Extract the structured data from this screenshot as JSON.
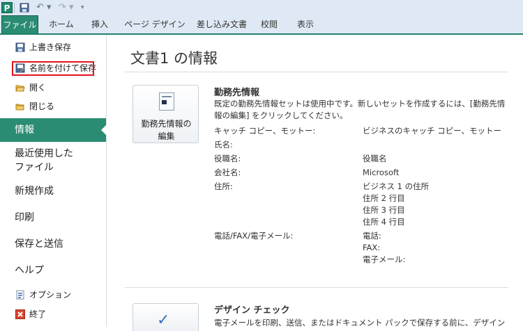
{
  "quick_access": {
    "app_icon": "P",
    "save_icon": "save-icon",
    "undo_icon": "undo-icon",
    "redo_icon": "redo-icon"
  },
  "tabs": [
    "ファイル",
    "ホーム",
    "挿入",
    "ページ デザイン",
    "差し込み文書",
    "校閲",
    "表示"
  ],
  "sidebar": {
    "save": "上書き保存",
    "save_as": "名前を付けて保存",
    "open": "開く",
    "close": "閉じる",
    "info": "情報",
    "recent_line1": "最近使用した",
    "recent_line2": "ファイル",
    "new": "新規作成",
    "print": "印刷",
    "save_send": "保存と送信",
    "help": "ヘルプ",
    "options": "オプション",
    "exit": "終了"
  },
  "main": {
    "title": "文書1 の情報",
    "edit_button_line1": "勤務先情報の",
    "edit_button_line2": "編集",
    "business_info_heading": "勤務先情報",
    "business_info_desc": "既定の勤務先情報セットは使用中です。新しいセットを作成するには、[勤務先情報の編集] をクリックしてください。",
    "fields": [
      {
        "label": "キャッチ コピー、モットー:",
        "value": "ビジネスのキャッチ コピー、モットー"
      },
      {
        "label": "氏名:",
        "value": ""
      },
      {
        "label": "役職名:",
        "value": "役職名"
      },
      {
        "label": "会社名:",
        "value": "Microsoft"
      },
      {
        "label": "住所:",
        "value": "ビジネス 1 の住所"
      },
      {
        "label": "",
        "value": "住所 2 行目"
      },
      {
        "label": "",
        "value": "住所 3 行目"
      },
      {
        "label": "",
        "value": "住所 4 行目"
      },
      {
        "label": "電話/FAX/電子メール:",
        "value": "電話:"
      },
      {
        "label": "",
        "value": "FAX:"
      },
      {
        "label": "",
        "value": "電子メール:"
      }
    ],
    "design_check_heading": "デザイン チェック",
    "design_check_desc": "電子メールを印刷、送信、またはドキュメント パックで保存する前に、デザイン"
  }
}
